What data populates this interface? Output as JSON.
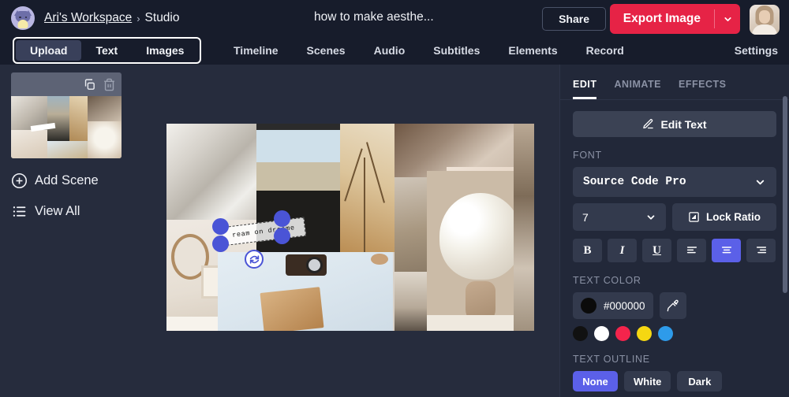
{
  "header": {
    "workspace": "Ari's Workspace",
    "separator": "›",
    "current": "Studio",
    "project_title": "how to make aesthe...",
    "share_label": "Share",
    "export_label": "Export Image",
    "accent_red": "#e62346"
  },
  "nav": {
    "grouped": [
      {
        "label": "Upload",
        "active": true
      },
      {
        "label": "Text",
        "active": false
      },
      {
        "label": "Images",
        "active": false
      }
    ],
    "items": [
      {
        "label": "Timeline"
      },
      {
        "label": "Scenes"
      },
      {
        "label": "Audio"
      },
      {
        "label": "Subtitles"
      },
      {
        "label": "Elements"
      },
      {
        "label": "Record"
      }
    ],
    "settings_label": "Settings"
  },
  "left_panel": {
    "scene_tools": [
      {
        "icon": "duplicate-icon"
      },
      {
        "icon": "trash-icon"
      }
    ],
    "actions": [
      {
        "icon": "plus-circle-icon",
        "label": "Add Scene"
      },
      {
        "icon": "list-icon",
        "label": "View All"
      }
    ]
  },
  "canvas": {
    "text_element": {
      "value": "ream on dreame",
      "rotation": "-7deg",
      "handle_color": "#4a54d6"
    }
  },
  "right_panel": {
    "tabs": [
      {
        "label": "EDIT",
        "active": true
      },
      {
        "label": "ANIMATE",
        "active": false
      },
      {
        "label": "EFFECTS",
        "active": false
      }
    ],
    "edit_text_label": "Edit Text",
    "font_section_label": "FONT",
    "font_family": "Source Code Pro",
    "font_size": "7",
    "lock_ratio_label": "Lock Ratio",
    "format_buttons": [
      {
        "name": "bold",
        "glyph": "B",
        "active": false
      },
      {
        "name": "italic",
        "glyph": "I",
        "active": false
      },
      {
        "name": "underline",
        "glyph": "U",
        "active": false
      },
      {
        "name": "align-left",
        "glyph": "",
        "active": false
      },
      {
        "name": "align-center",
        "glyph": "",
        "active": true
      },
      {
        "name": "align-right",
        "glyph": "",
        "active": false
      }
    ],
    "text_color_label": "TEXT COLOR",
    "text_color_hex": "#000000",
    "text_color_swatches": [
      "#111111",
      "#ffffff",
      "#f4244c",
      "#f5d712",
      "#2e9bea"
    ],
    "text_outline_label": "TEXT OUTLINE",
    "outline_options": [
      {
        "label": "None",
        "active": true
      },
      {
        "label": "White",
        "active": false
      },
      {
        "label": "Dark",
        "active": false
      }
    ]
  }
}
